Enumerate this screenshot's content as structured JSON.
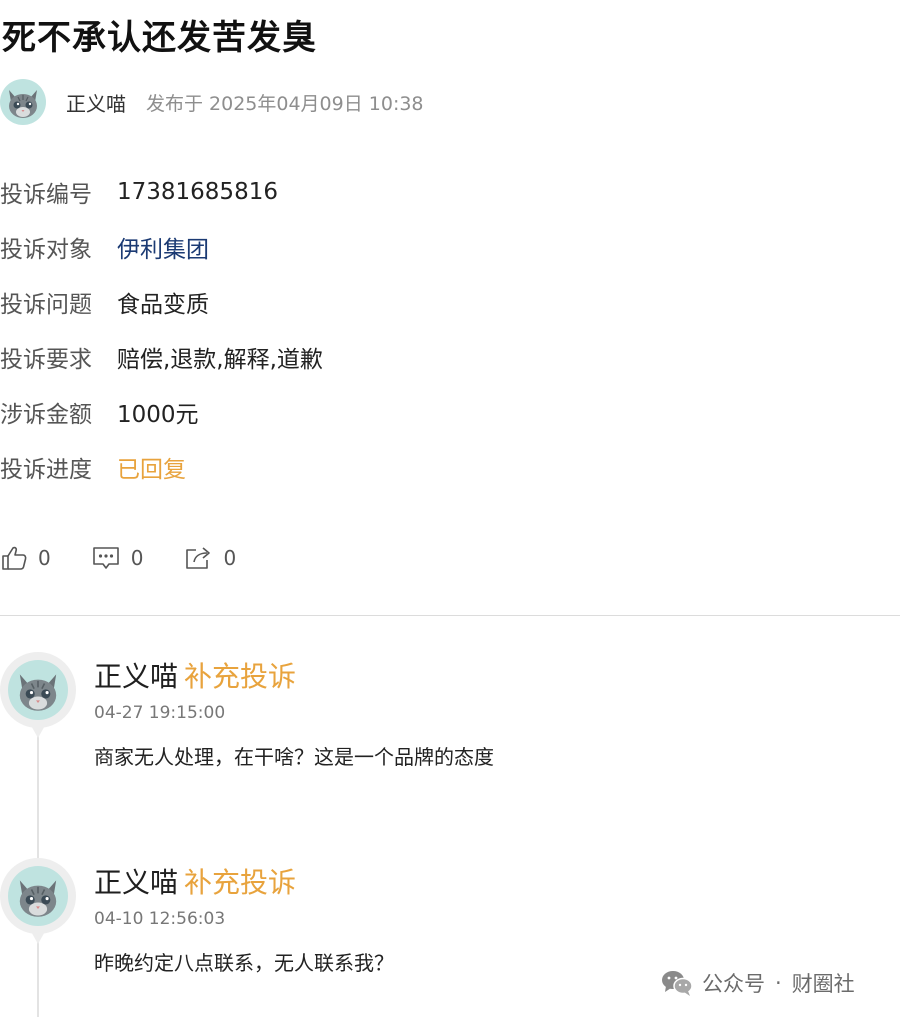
{
  "post": {
    "title": "死不承认还发苦发臭",
    "author": "正义喵",
    "published_label": "发布于",
    "published_time": "2025年04月09日 10:38"
  },
  "info": [
    {
      "label": "投诉编号",
      "value": "17381685816",
      "style": "normal"
    },
    {
      "label": "投诉对象",
      "value": "伊利集团",
      "style": "link"
    },
    {
      "label": "投诉问题",
      "value": "食品变质",
      "style": "normal"
    },
    {
      "label": "投诉要求",
      "value": "赔偿,退款,解释,道歉",
      "style": "normal"
    },
    {
      "label": "涉诉金额",
      "value": "1000元",
      "style": "normal"
    },
    {
      "label": "投诉进度",
      "value": "已回复",
      "style": "status"
    }
  ],
  "actions": {
    "like_count": "0",
    "comment_count": "0",
    "share_count": "0"
  },
  "timeline": [
    {
      "author": "正义喵",
      "type": "补充投诉",
      "time": "04-27 19:15:00",
      "text": "商家无人处理，在干啥？这是一个品牌的态度"
    },
    {
      "author": "正义喵",
      "type": "补充投诉",
      "time": "04-10 12:56:03",
      "text": "昨晚约定八点联系，无人联系我？"
    }
  ],
  "watermark": {
    "left": "公众号",
    "separator": "·",
    "right": "财圈社"
  },
  "colors": {
    "status_orange": "#e8a33d",
    "link_blue": "#1b3a73",
    "avatar_bg": "#bfe3e0"
  }
}
